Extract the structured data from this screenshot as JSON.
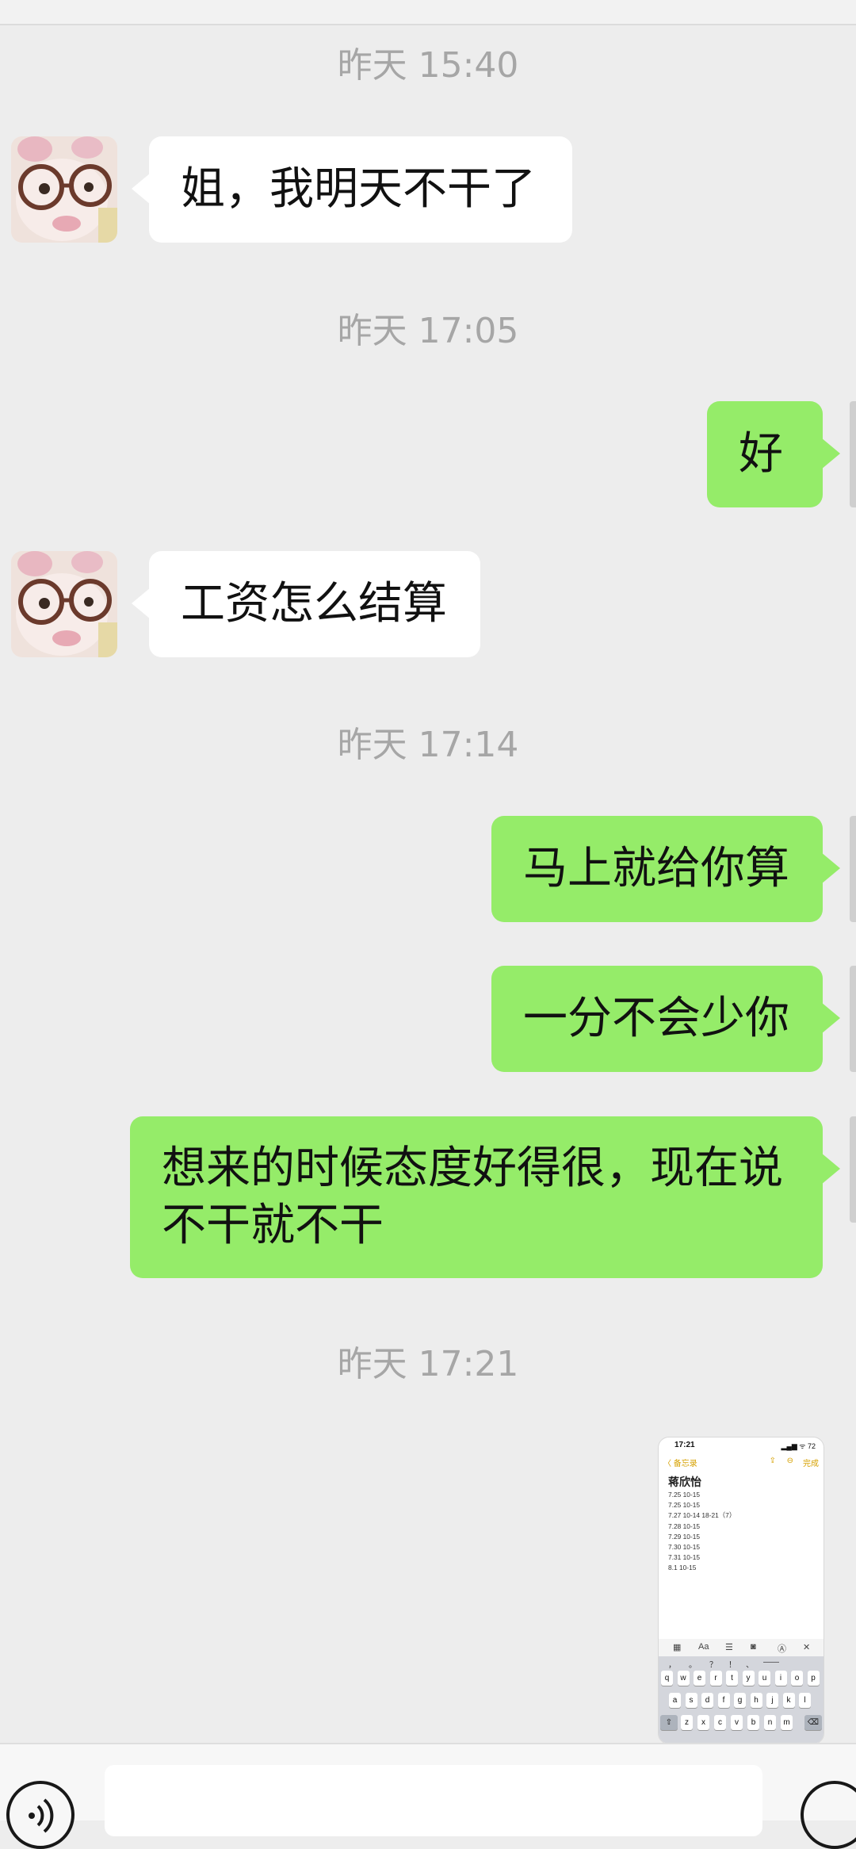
{
  "messages": {
    "ts1": "昨天 15:40",
    "m1": "姐，我明天不干了",
    "ts2": "昨天 17:05",
    "m2": "好",
    "m3": "工资怎么结算",
    "ts3": "昨天 17:14",
    "m4": "马上就给你算",
    "m5": "一分不会少你",
    "m6_line1": "想来的时候态度好得很，现在说",
    "m6_line2": "不干就不干",
    "ts4": "昨天 17:21"
  },
  "screenshot_thumb": {
    "clock": "17:21",
    "signal": "▂▄▆ ᯤ 72",
    "back": "〈 备忘录",
    "done": "完成",
    "title": "蒋欣怡",
    "lines": [
      "7.25 10-15",
      "7.25 10-15",
      "7.27 10-14 18-21（7）",
      "7.28 10-15",
      "7.29 10-15",
      "7.30 10-15",
      "7.31 10-15",
      "8.1 10-15"
    ],
    "toolbar": [
      "▦",
      "Aa",
      "☰",
      "◙",
      "Ⓐ",
      "✕"
    ],
    "punct": [
      "，",
      "。",
      "？",
      "！",
      "、",
      "——"
    ],
    "row1": [
      "q",
      "w",
      "e",
      "r",
      "t",
      "y",
      "u",
      "i",
      "o",
      "p"
    ],
    "row2": [
      "a",
      "s",
      "d",
      "f",
      "g",
      "h",
      "j",
      "k",
      "l"
    ],
    "row3": [
      "z",
      "x",
      "c",
      "v",
      "b",
      "n",
      "m"
    ],
    "shift": "⇧",
    "del": "⌫"
  },
  "colors": {
    "background": "#ededed",
    "bubble_self": "#95ec69",
    "bubble_other": "#ffffff",
    "timestamp": "#a6a6a6"
  },
  "icons": {
    "voice": "voice-wave-icon",
    "plus": "plus-icon"
  }
}
